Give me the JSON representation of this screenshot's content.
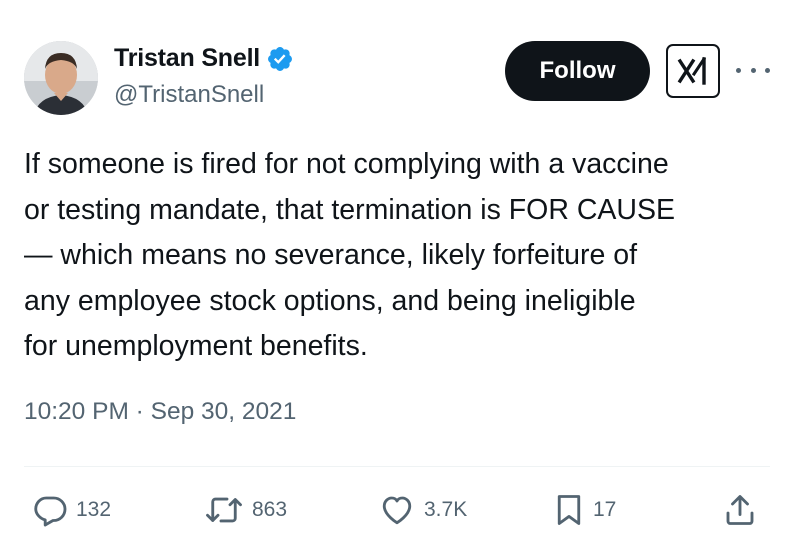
{
  "author": {
    "display_name": "Tristan Snell",
    "handle": "@TristanSnell",
    "verified": true,
    "verified_color": "#1d9bf0"
  },
  "header": {
    "follow_label": "Follow",
    "xai_icon": "xai-grok-icon",
    "more_icon": "more-horizontal-icon"
  },
  "tweet": {
    "lines": [
      "If someone is fired for not complying with a vaccine",
      "or testing mandate, that termination is FOR CAUSE",
      "— which means no severance, likely forfeiture of",
      "any employee stock options, and being ineligible",
      "for unemployment benefits."
    ],
    "timestamp": "10:20 PM · Sep 30, 2021"
  },
  "actions": {
    "replies": "132",
    "reposts": "863",
    "likes": "3.7K",
    "bookmarks": "17",
    "share_icon": "share-icon"
  },
  "colors": {
    "text_primary": "#0f1419",
    "text_secondary": "#536471",
    "divider": "#eff3f4"
  }
}
